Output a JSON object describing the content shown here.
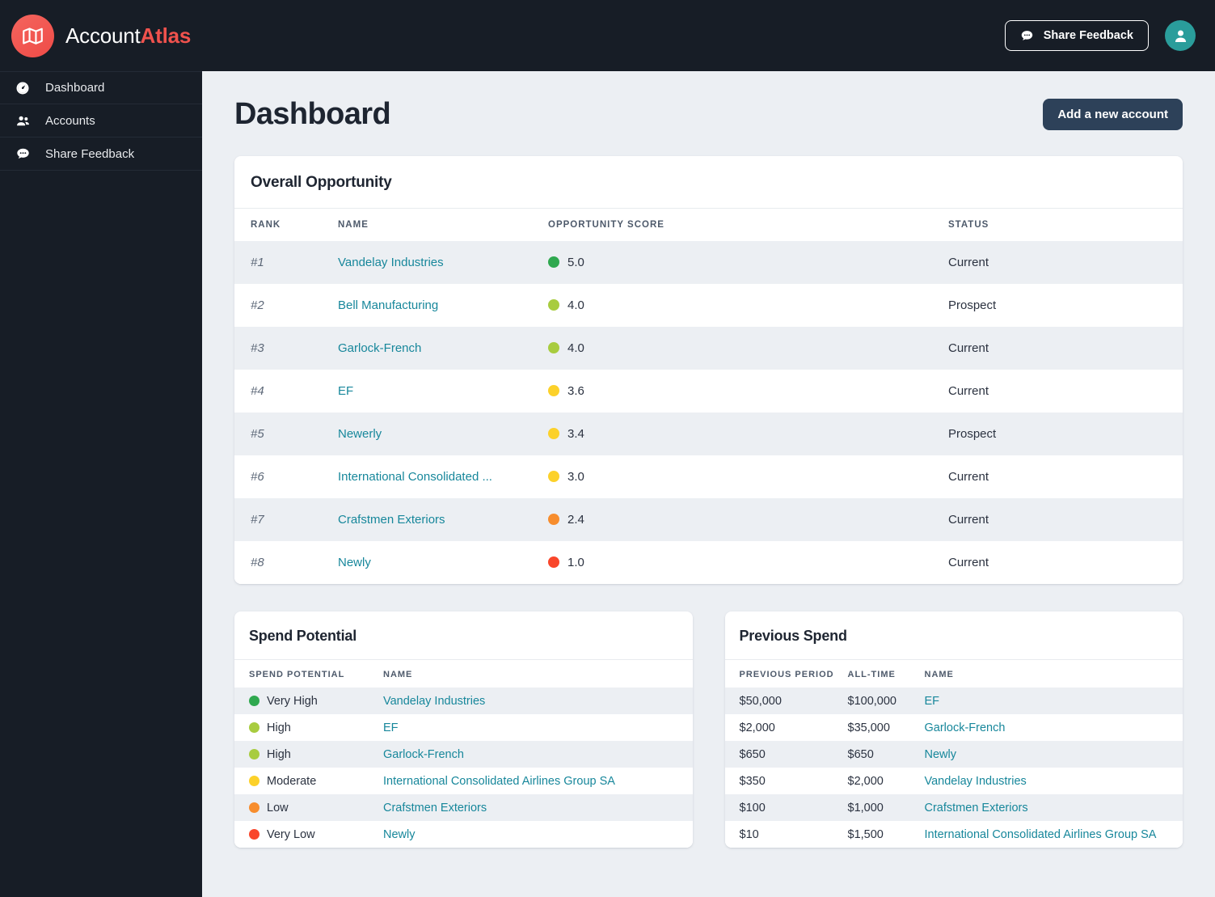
{
  "brand": {
    "name_prefix": "Account",
    "name_suffix": "Atlas",
    "logo_icon": "map-icon"
  },
  "topbar": {
    "feedback_label": "Share Feedback",
    "feedback_icon": "chat-bubble-icon",
    "avatar_icon": "user-avatar-icon"
  },
  "sidebar": {
    "items": [
      {
        "label": "Dashboard",
        "icon": "speedometer-icon"
      },
      {
        "label": "Accounts",
        "icon": "people-icon"
      },
      {
        "label": "Share Feedback",
        "icon": "chat-bubble-icon"
      }
    ]
  },
  "page": {
    "title": "Dashboard",
    "add_account_label": "Add a new account"
  },
  "colors": {
    "accent_red": "#f0524d",
    "link_teal": "#17879b",
    "primary_button": "#2d4159",
    "avatar_teal": "#2a9d9b",
    "score_very_high": "#2fa84f",
    "score_high": "#a8cc3f",
    "score_moderate": "#fcd12a",
    "score_low": "#f78d2d",
    "score_very_low": "#f9462b"
  },
  "overall_opportunity": {
    "title": "Overall Opportunity",
    "columns": [
      "RANK",
      "NAME",
      "OPPORTUNITY SCORE",
      "STATUS"
    ],
    "rows": [
      {
        "rank": "#1",
        "name": "Vandelay Industries",
        "score": "5.0",
        "dot": "#2fa84f",
        "status": "Current"
      },
      {
        "rank": "#2",
        "name": "Bell Manufacturing",
        "score": "4.0",
        "dot": "#a8cc3f",
        "status": "Prospect"
      },
      {
        "rank": "#3",
        "name": "Garlock-French",
        "score": "4.0",
        "dot": "#a8cc3f",
        "status": "Current"
      },
      {
        "rank": "#4",
        "name": "EF",
        "score": "3.6",
        "dot": "#fcd12a",
        "status": "Current"
      },
      {
        "rank": "#5",
        "name": "Newerly",
        "score": "3.4",
        "dot": "#fcd12a",
        "status": "Prospect"
      },
      {
        "rank": "#6",
        "name": "International Consolidated ...",
        "score": "3.0",
        "dot": "#fcd12a",
        "status": "Current"
      },
      {
        "rank": "#7",
        "name": "Crafstmen Exteriors",
        "score": "2.4",
        "dot": "#f78d2d",
        "status": "Current"
      },
      {
        "rank": "#8",
        "name": "Newly",
        "score": "1.0",
        "dot": "#f9462b",
        "status": "Current"
      }
    ]
  },
  "spend_potential": {
    "title": "Spend Potential",
    "columns": [
      "SPEND POTENTIAL",
      "NAME"
    ],
    "rows": [
      {
        "level": "Very High",
        "dot": "#2fa84f",
        "name": "Vandelay Industries"
      },
      {
        "level": "High",
        "dot": "#a8cc3f",
        "name": "EF"
      },
      {
        "level": "High",
        "dot": "#a8cc3f",
        "name": "Garlock-French"
      },
      {
        "level": "Moderate",
        "dot": "#fcd12a",
        "name": "International Consolidated Airlines Group SA"
      },
      {
        "level": "Low",
        "dot": "#f78d2d",
        "name": "Crafstmen Exteriors"
      },
      {
        "level": "Very Low",
        "dot": "#f9462b",
        "name": "Newly"
      }
    ]
  },
  "previous_spend": {
    "title": "Previous Spend",
    "columns": [
      "PREVIOUS PERIOD",
      "ALL-TIME",
      "NAME"
    ],
    "rows": [
      {
        "previous_period": "$50,000",
        "all_time": "$100,000",
        "name": "EF"
      },
      {
        "previous_period": "$2,000",
        "all_time": "$35,000",
        "name": "Garlock-French"
      },
      {
        "previous_period": "$650",
        "all_time": "$650",
        "name": "Newly"
      },
      {
        "previous_period": "$350",
        "all_time": "$2,000",
        "name": "Vandelay Industries"
      },
      {
        "previous_period": "$100",
        "all_time": "$1,000",
        "name": "Crafstmen Exteriors"
      },
      {
        "previous_period": "$10",
        "all_time": "$1,500",
        "name": "International Consolidated Airlines Group SA"
      }
    ]
  }
}
